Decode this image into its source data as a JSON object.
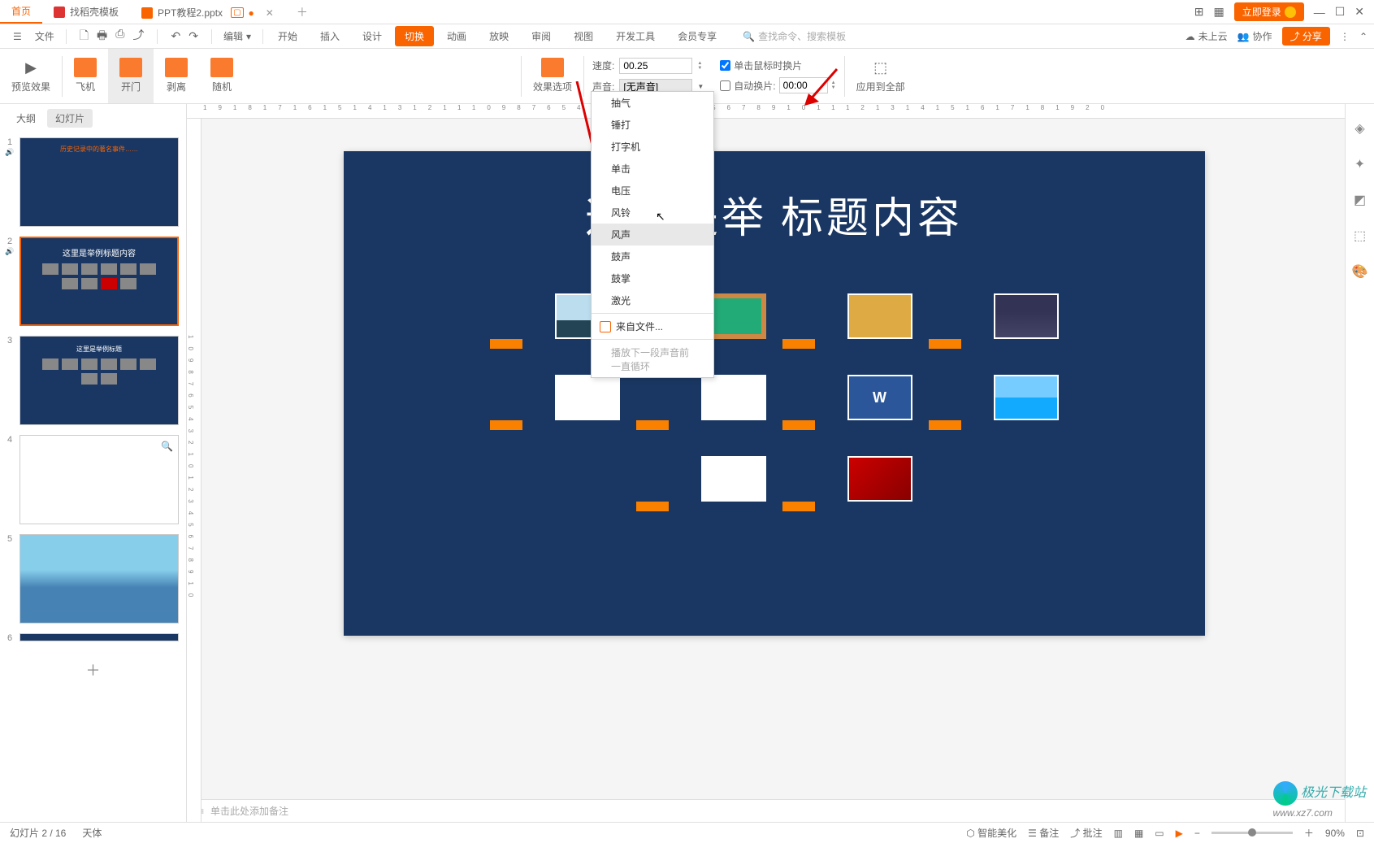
{
  "titlebar": {
    "home": "首页",
    "tab1": "找稻壳模板",
    "tab2": "PPT教程2.pptx",
    "login": "立即登录"
  },
  "menubar": {
    "file": "文件",
    "edit_drop": "编辑",
    "tabs": {
      "start": "开始",
      "insert": "插入",
      "design": "设计",
      "transition": "切换",
      "anim": "动画",
      "show": "放映",
      "review": "审阅",
      "view": "视图",
      "dev": "开发工具",
      "member": "会员专享"
    },
    "search_ph": "查找命令、搜索模板",
    "cloud": "未上云",
    "collab": "协作",
    "share": "分享"
  },
  "ribbon": {
    "preview": "预览效果",
    "trans": {
      "plane": "飞机",
      "door": "开门",
      "peel": "剥离",
      "random": "随机"
    },
    "effect_opts": "效果选项",
    "speed_lbl": "速度:",
    "speed_val": "00.25",
    "sound_lbl": "声音:",
    "sound_val": "[无声音]",
    "click_lbl": "单击鼠标时换片",
    "auto_lbl": "自动换片:",
    "auto_val": "00:00",
    "apply_all": "应用到全部"
  },
  "dropdown": {
    "items": {
      "i0": "抽气",
      "i1": "锤打",
      "i2": "打字机",
      "i3": "单击",
      "i4": "电压",
      "i5": "风铃",
      "i6": "风声",
      "i7": "鼓声",
      "i8": "鼓掌",
      "i9": "激光"
    },
    "from_file": "来自文件...",
    "loop": "播放下一段声音前一直循环"
  },
  "slides": {
    "tab_outline": "大纲",
    "tab_slides": "幻灯片",
    "t1_orange": "历史记录中的著名事件……",
    "t2_title": "这里是举例标题内容",
    "t3_title": "这里是举例标题"
  },
  "canvas": {
    "title": "这里是举           标题内容"
  },
  "notes": {
    "placeholder": "单击此处添加备注"
  },
  "status": {
    "left": "幻灯片 2 / 16",
    "font": "天体",
    "beautify": "智能美化",
    "remarks": "备注",
    "annotate": "批注",
    "zoom": "90%"
  },
  "watermark": {
    "site": "极光下载站",
    "url": "www.xz7.com"
  }
}
